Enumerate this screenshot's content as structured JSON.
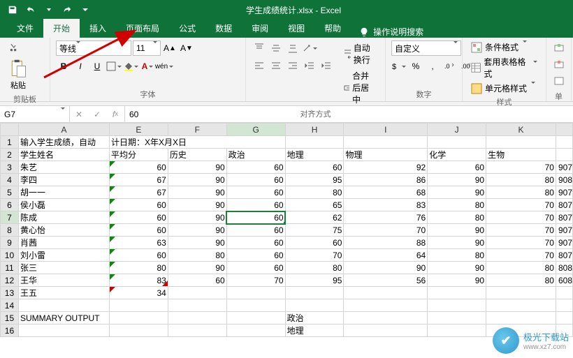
{
  "app": {
    "title": "学生成绩统计.xlsx - Excel"
  },
  "qat": {
    "save": "save-icon",
    "undo": "undo-icon",
    "redo": "redo-icon"
  },
  "tabs": {
    "file": "文件",
    "home": "开始",
    "insert": "插入",
    "pageLayout": "页面布局",
    "formulas": "公式",
    "data": "数据",
    "review": "审阅",
    "view": "视图",
    "help": "帮助",
    "tellMe": "操作说明搜索"
  },
  "ribbon": {
    "clipboard": {
      "label": "剪贴板",
      "paste": "粘贴"
    },
    "font": {
      "label": "字体",
      "name": "等线",
      "size": "11"
    },
    "alignment": {
      "label": "对齐方式",
      "wrap": "自动换行",
      "merge": "合并后居中"
    },
    "number": {
      "label": "数字",
      "format": "自定义"
    },
    "styles": {
      "label": "样式",
      "condFmt": "条件格式",
      "tableFmt": "套用表格格式",
      "cellStyle": "单元格样式"
    },
    "cellsTrunc": "单"
  },
  "nameBox": "G7",
  "formulaValue": "60",
  "columns": [
    "A",
    "E",
    "F",
    "G",
    "H",
    "I",
    "J",
    "K",
    ""
  ],
  "header1": {
    "textA": "输入学生成绩，自动",
    "textRest": "计日期：X年X月X日"
  },
  "header2": [
    "学生姓名",
    "平均分",
    "历史",
    "政治",
    "地理",
    "物理",
    "化学",
    "生物",
    ""
  ],
  "rows": [
    {
      "r": 3,
      "name": "朱艺",
      "avg": 60,
      "v": [
        90,
        60,
        60,
        92,
        60,
        70
      ],
      "suf": "907"
    },
    {
      "r": 4,
      "name": "李四",
      "avg": 67,
      "v": [
        90,
        60,
        95,
        86,
        90,
        80
      ],
      "suf": "908"
    },
    {
      "r": 5,
      "name": "胡一一",
      "avg": 67,
      "v": [
        90,
        60,
        80,
        68,
        90,
        80
      ],
      "suf": "907"
    },
    {
      "r": 6,
      "name": "侯小磊",
      "avg": 60,
      "v": [
        90,
        60,
        65,
        83,
        80,
        70
      ],
      "suf": "807"
    },
    {
      "r": 7,
      "name": "陈成",
      "avg": 60,
      "v": [
        90,
        60,
        62,
        76,
        80,
        70
      ],
      "suf": "807"
    },
    {
      "r": 8,
      "name": "黄心怡",
      "avg": 60,
      "v": [
        90,
        60,
        75,
        70,
        90,
        70
      ],
      "suf": "907"
    },
    {
      "r": 9,
      "name": "肖茜",
      "avg": 63,
      "v": [
        90,
        60,
        60,
        88,
        90,
        70
      ],
      "suf": "907"
    },
    {
      "r": 10,
      "name": "刘小雷",
      "avg": 60,
      "v": [
        80,
        60,
        70,
        64,
        80,
        70
      ],
      "suf": "807"
    },
    {
      "r": 11,
      "name": "张三",
      "avg": 80,
      "v": [
        90,
        60,
        80,
        90,
        90,
        80
      ],
      "suf": "808"
    },
    {
      "r": 12,
      "name": "王华",
      "avg": 83,
      "v": [
        60,
        70,
        95,
        56,
        90,
        80
      ],
      "suf": "608"
    },
    {
      "r": 13,
      "name": "王五",
      "avg": 34,
      "v": [
        "",
        "",
        "",
        "",
        "",
        ""
      ],
      "suf": ""
    }
  ],
  "summaryRows": [
    {
      "r": 15,
      "a": "SUMMARY OUTPUT",
      "h": "政治"
    },
    {
      "r": 16,
      "a": "",
      "h": "地理"
    }
  ],
  "watermark": {
    "brand": "极光下载站",
    "url": "www.xz7.com"
  },
  "chart_data": {
    "type": "table",
    "title": "学生成绩统计",
    "columns": [
      "学生姓名",
      "平均分",
      "历史",
      "政治",
      "地理",
      "物理",
      "化学",
      "生物"
    ],
    "rows": [
      [
        "朱艺",
        60,
        90,
        60,
        60,
        92,
        60,
        70
      ],
      [
        "李四",
        67,
        90,
        60,
        95,
        86,
        90,
        80
      ],
      [
        "胡一一",
        67,
        90,
        60,
        80,
        68,
        90,
        80
      ],
      [
        "侯小磊",
        60,
        90,
        60,
        65,
        83,
        80,
        70
      ],
      [
        "陈成",
        60,
        90,
        60,
        62,
        76,
        80,
        70
      ],
      [
        "黄心怡",
        60,
        90,
        60,
        75,
        70,
        90,
        70
      ],
      [
        "肖茜",
        63,
        90,
        60,
        60,
        88,
        90,
        70
      ],
      [
        "刘小雷",
        60,
        80,
        60,
        70,
        64,
        80,
        70
      ],
      [
        "张三",
        80,
        90,
        60,
        80,
        90,
        90,
        80
      ],
      [
        "王华",
        83,
        60,
        70,
        95,
        56,
        90,
        80
      ],
      [
        "王五",
        34,
        null,
        null,
        null,
        null,
        null,
        null
      ]
    ]
  }
}
